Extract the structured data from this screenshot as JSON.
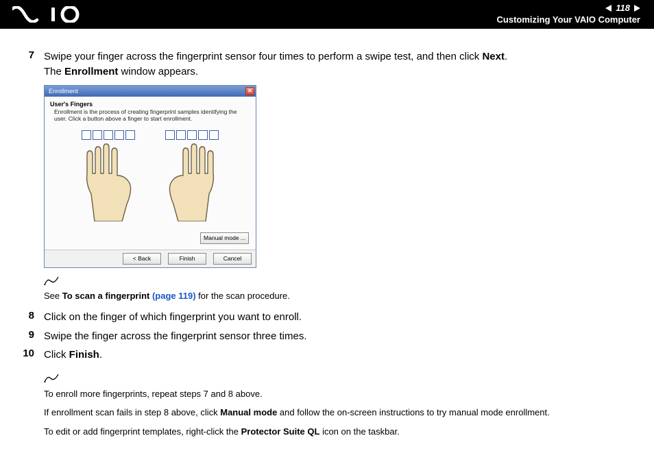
{
  "header": {
    "page_number": "118",
    "section_title": "Customizing Your VAIO Computer"
  },
  "steps": {
    "s7": {
      "num": "7",
      "text_a": "Swipe your finger across the fingerprint sensor four times to perform a swipe test, and then click ",
      "text_b": "Next",
      "text_c": ".",
      "line2_a": "The ",
      "line2_b": "Enrollment",
      "line2_c": " window appears."
    },
    "s8": {
      "num": "8",
      "text_a": "Click on the finger of which fingerprint you want to enroll."
    },
    "s9": {
      "num": "9",
      "text_a": "Swipe the finger across the fingerprint sensor three times."
    },
    "s10": {
      "num": "10",
      "text_a": "Click ",
      "text_b": "Finish",
      "text_c": "."
    }
  },
  "enroll": {
    "title": "Enrollment",
    "users_fingers": "User's Fingers",
    "desc": "Enrollment is the process of creating fingerprint samples identifying the user. Click a button above a finger to start enrollment.",
    "manual_mode": "Manual mode ...",
    "back": "< Back",
    "finish": "Finish",
    "cancel": "Cancel"
  },
  "note1": {
    "lead": "See ",
    "bold": "To scan a fingerprint ",
    "link": "(page 119)",
    "tail": " for the scan procedure."
  },
  "note2": {
    "line1": "To enroll more fingerprints, repeat steps 7 and 8 above.",
    "line2_a": "If enrollment scan fails in step 8 above, click ",
    "line2_b": "Manual mode",
    "line2_c": " and follow the on-screen instructions to try manual mode enrollment.",
    "line3_a": "To edit or add fingerprint templates, right-click the ",
    "line3_b": "Protector Suite QL",
    "line3_c": " icon on the taskbar."
  }
}
